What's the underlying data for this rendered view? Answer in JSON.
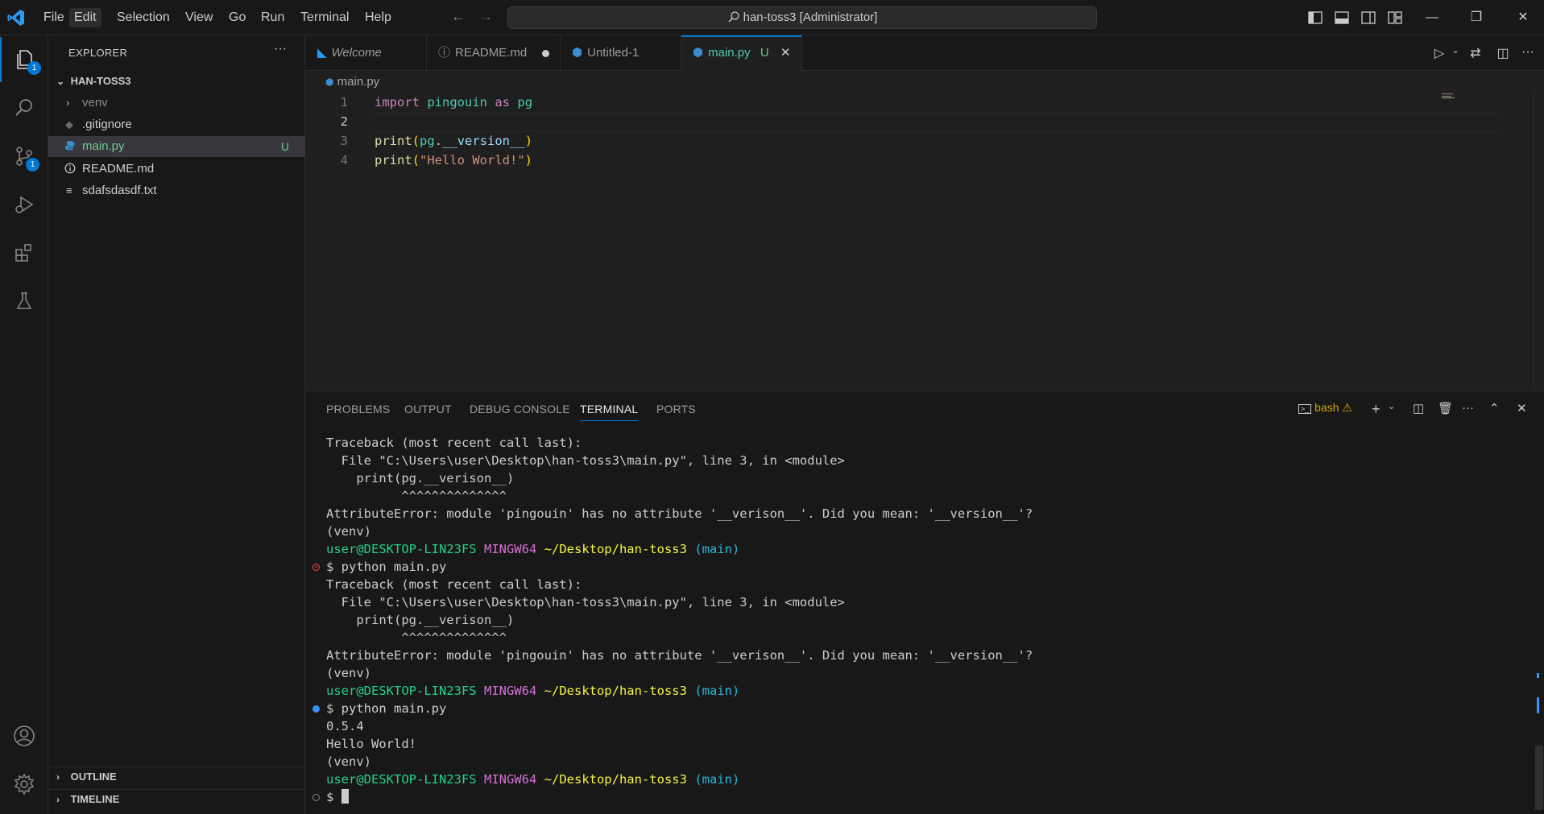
{
  "titlebar": {
    "menus": [
      "File",
      "Edit",
      "Selection",
      "View",
      "Go",
      "Run",
      "Terminal",
      "Help"
    ],
    "active_menu": "Edit",
    "command_center": "han-toss3 [Administrator]",
    "window_controls": {
      "minimize": "—",
      "restore": "❐",
      "close": "✕"
    }
  },
  "activity_bar": {
    "items": [
      {
        "name": "explorer",
        "icon": "files-icon",
        "badge": "1"
      },
      {
        "name": "search",
        "icon": "search-icon"
      },
      {
        "name": "source-control",
        "icon": "source-control-icon",
        "badge": "1"
      },
      {
        "name": "run-debug",
        "icon": "run-debug-icon"
      },
      {
        "name": "extensions",
        "icon": "extensions-icon"
      },
      {
        "name": "testing",
        "icon": "beaker-icon"
      }
    ],
    "bottom": [
      {
        "name": "accounts",
        "icon": "account-icon"
      },
      {
        "name": "manage",
        "icon": "gear-icon"
      }
    ]
  },
  "sidebar": {
    "title": "EXPLORER",
    "more": "···",
    "folder": "HAN-TOSS3",
    "items": [
      {
        "label": "venv",
        "kind": "folder"
      },
      {
        "label": ".gitignore",
        "kind": "gitignore"
      },
      {
        "label": "main.py",
        "kind": "python",
        "status": "U",
        "selected": true
      },
      {
        "label": "README.md",
        "kind": "info"
      },
      {
        "label": "sdafsdasdf.txt",
        "kind": "text"
      }
    ],
    "outline": "OUTLINE",
    "timeline": "TIMELINE"
  },
  "tabs": [
    {
      "label": "Welcome",
      "icon": "vscode-icon"
    },
    {
      "label": "README.md",
      "icon": "info-icon",
      "dirty": true
    },
    {
      "label": "Untitled-1",
      "icon": "python-icon"
    },
    {
      "label": "main.py",
      "icon": "python-icon",
      "status": "U",
      "active": true
    }
  ],
  "editor": {
    "breadcrumb": "main.py",
    "line_numbers": [
      "1",
      "2",
      "3",
      "4"
    ],
    "line1": {
      "kw": "import",
      "mod": "pingouin",
      "kw2": "as",
      "alias": "pg"
    },
    "line3": {
      "fn": "print",
      "open": "(",
      "obj": "pg",
      "dot": ".",
      "attr": "__version__",
      "close": ")"
    },
    "line4": {
      "fn": "print",
      "open": "(",
      "str": "\"Hello World!\"",
      "close": ")"
    }
  },
  "panel": {
    "tabs": [
      "PROBLEMS",
      "OUTPUT",
      "DEBUG CONSOLE",
      "TERMINAL",
      "PORTS"
    ],
    "active_tab": "TERMINAL",
    "shell": "bash"
  },
  "terminal": {
    "traceback_head": "Traceback (most recent call last):",
    "file_line": "  File \"C:\\Users\\user\\Desktop\\han-toss3\\main.py\", line 3, in <module>",
    "print_line": "    print(pg.__verison__)",
    "caret_line": "          ^^^^^^^^^^^^^^",
    "attr_error": "AttributeError: module 'pingouin' has no attribute '__verison__'. Did you mean: '__version__'?",
    "venv": "(venv)",
    "prompt_user": "user@DESKTOP-LIN23FS",
    "prompt_env": "MINGW64",
    "prompt_path": "~/Desktop/han-toss3",
    "prompt_branch": "(main)",
    "command": "$ python main.py",
    "output_version": "0.5.4",
    "output_hello": "Hello World!",
    "final_prompt": "$ "
  }
}
